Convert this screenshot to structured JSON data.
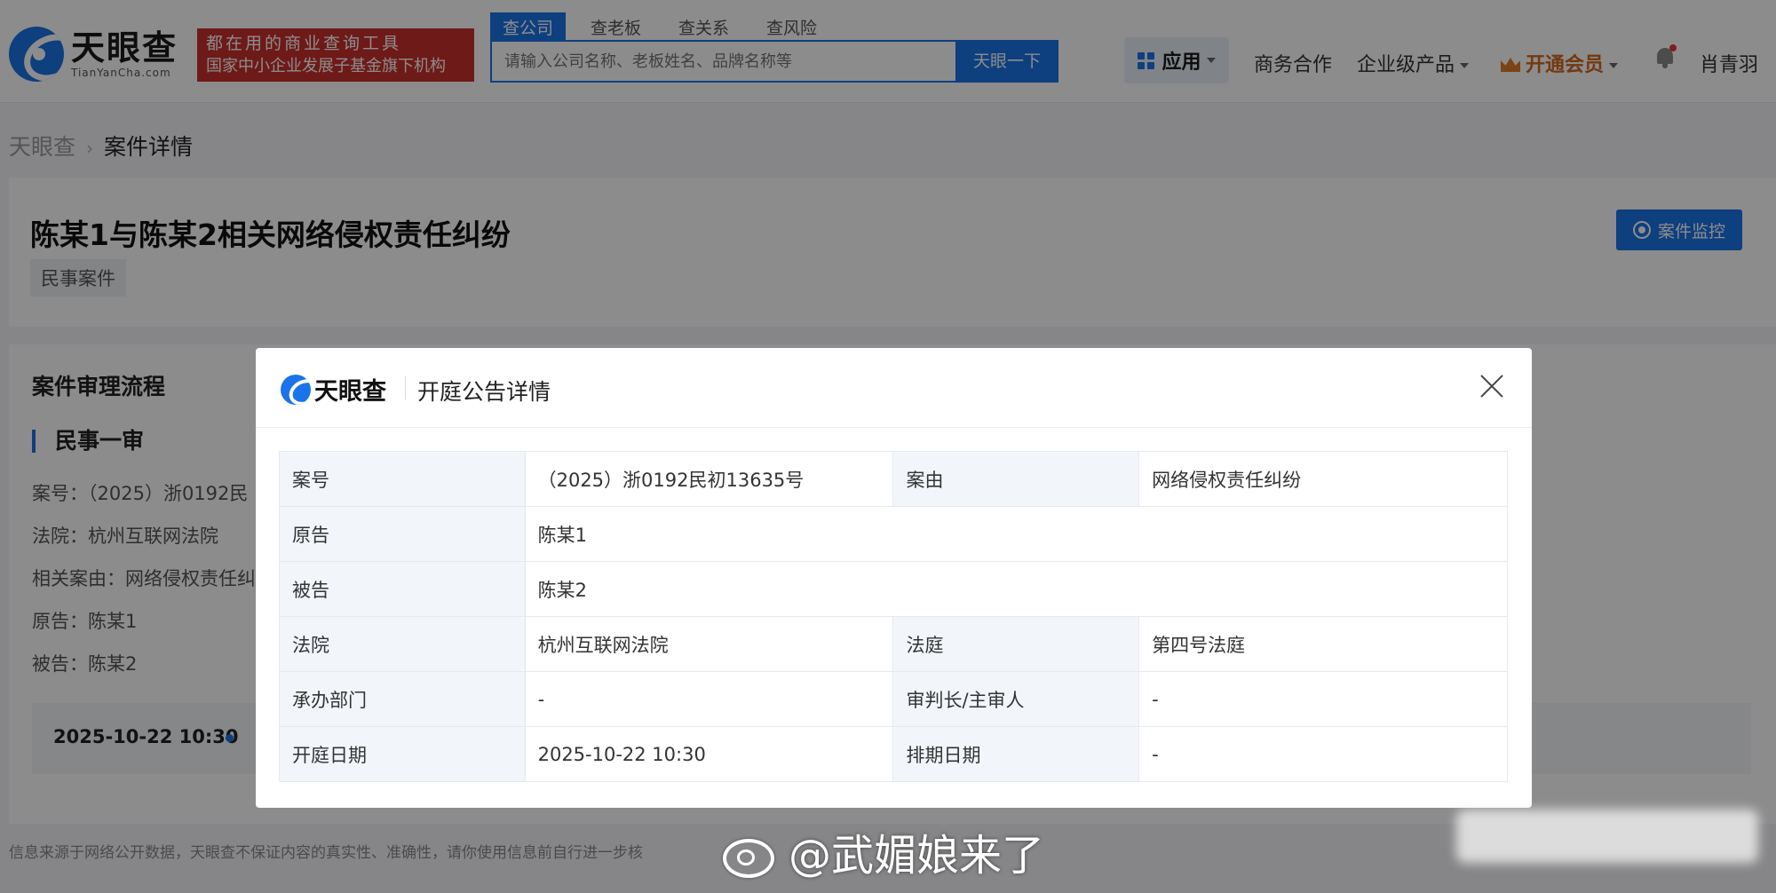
{
  "header": {
    "logo_cn": "天眼查",
    "logo_en": "TianYanCha.com",
    "slogan_line1": "都在用的商业查询工具",
    "slogan_line2": "国家中小企业发展子基金旗下机构",
    "search_tabs": [
      {
        "label": "查公司",
        "active": true
      },
      {
        "label": "查老板",
        "active": false
      },
      {
        "label": "查关系",
        "active": false
      },
      {
        "label": "查风险",
        "active": false
      }
    ],
    "search_placeholder": "请输入公司名称、老板姓名、品牌名称等",
    "search_button": "天眼一下",
    "nav_apps": "应用",
    "nav_business": "商务合作",
    "nav_enterprise": "企业级产品",
    "nav_vip": "开通会员",
    "user_name": "肖青羽"
  },
  "breadcrumb": {
    "home": "天眼查",
    "current": "案件详情"
  },
  "case": {
    "title": "陈某1与陈某2相关网络侵权责任纠纷",
    "tag": "民事案件",
    "monitor_button": "案件监控"
  },
  "flow": {
    "title": "案件审理流程",
    "stage": "民事一审",
    "case_no": "案号：（2025）浙0192民",
    "court": "法院：杭州互联网法院",
    "cause": "相关案由：网络侵权责任纠",
    "plaintiff": "原告：陈某1",
    "defendant": "被告：陈某2",
    "timeline_date": "2025-10-22 10:30"
  },
  "disclaimer": "信息来源于网络公开数据，天眼查不保证内容的真实性、准确性，请你使用信息前自行进一步核",
  "modal": {
    "logo": "天眼查",
    "title": "开庭公告详情",
    "rows": {
      "case_no_label": "案号",
      "case_no": "（2025）浙0192民初13635号",
      "cause_label": "案由",
      "cause": "网络侵权责任纠纷",
      "plaintiff_label": "原告",
      "plaintiff": "陈某1",
      "defendant_label": "被告",
      "defendant": "陈某2",
      "court_label": "法院",
      "court": "杭州互联网法院",
      "room_label": "法庭",
      "room": "第四号法庭",
      "dept_label": "承办部门",
      "dept": "-",
      "judge_label": "审判长/主审人",
      "judge": "-",
      "date_label": "开庭日期",
      "date": "2025-10-22 10:30",
      "schedule_label": "排期日期",
      "schedule": "-"
    }
  },
  "watermark": "@武媚娘来了",
  "colors": {
    "brand_blue": "#1a73e8",
    "slogan_red": "#c9302c",
    "vip_orange": "#d2691e"
  }
}
